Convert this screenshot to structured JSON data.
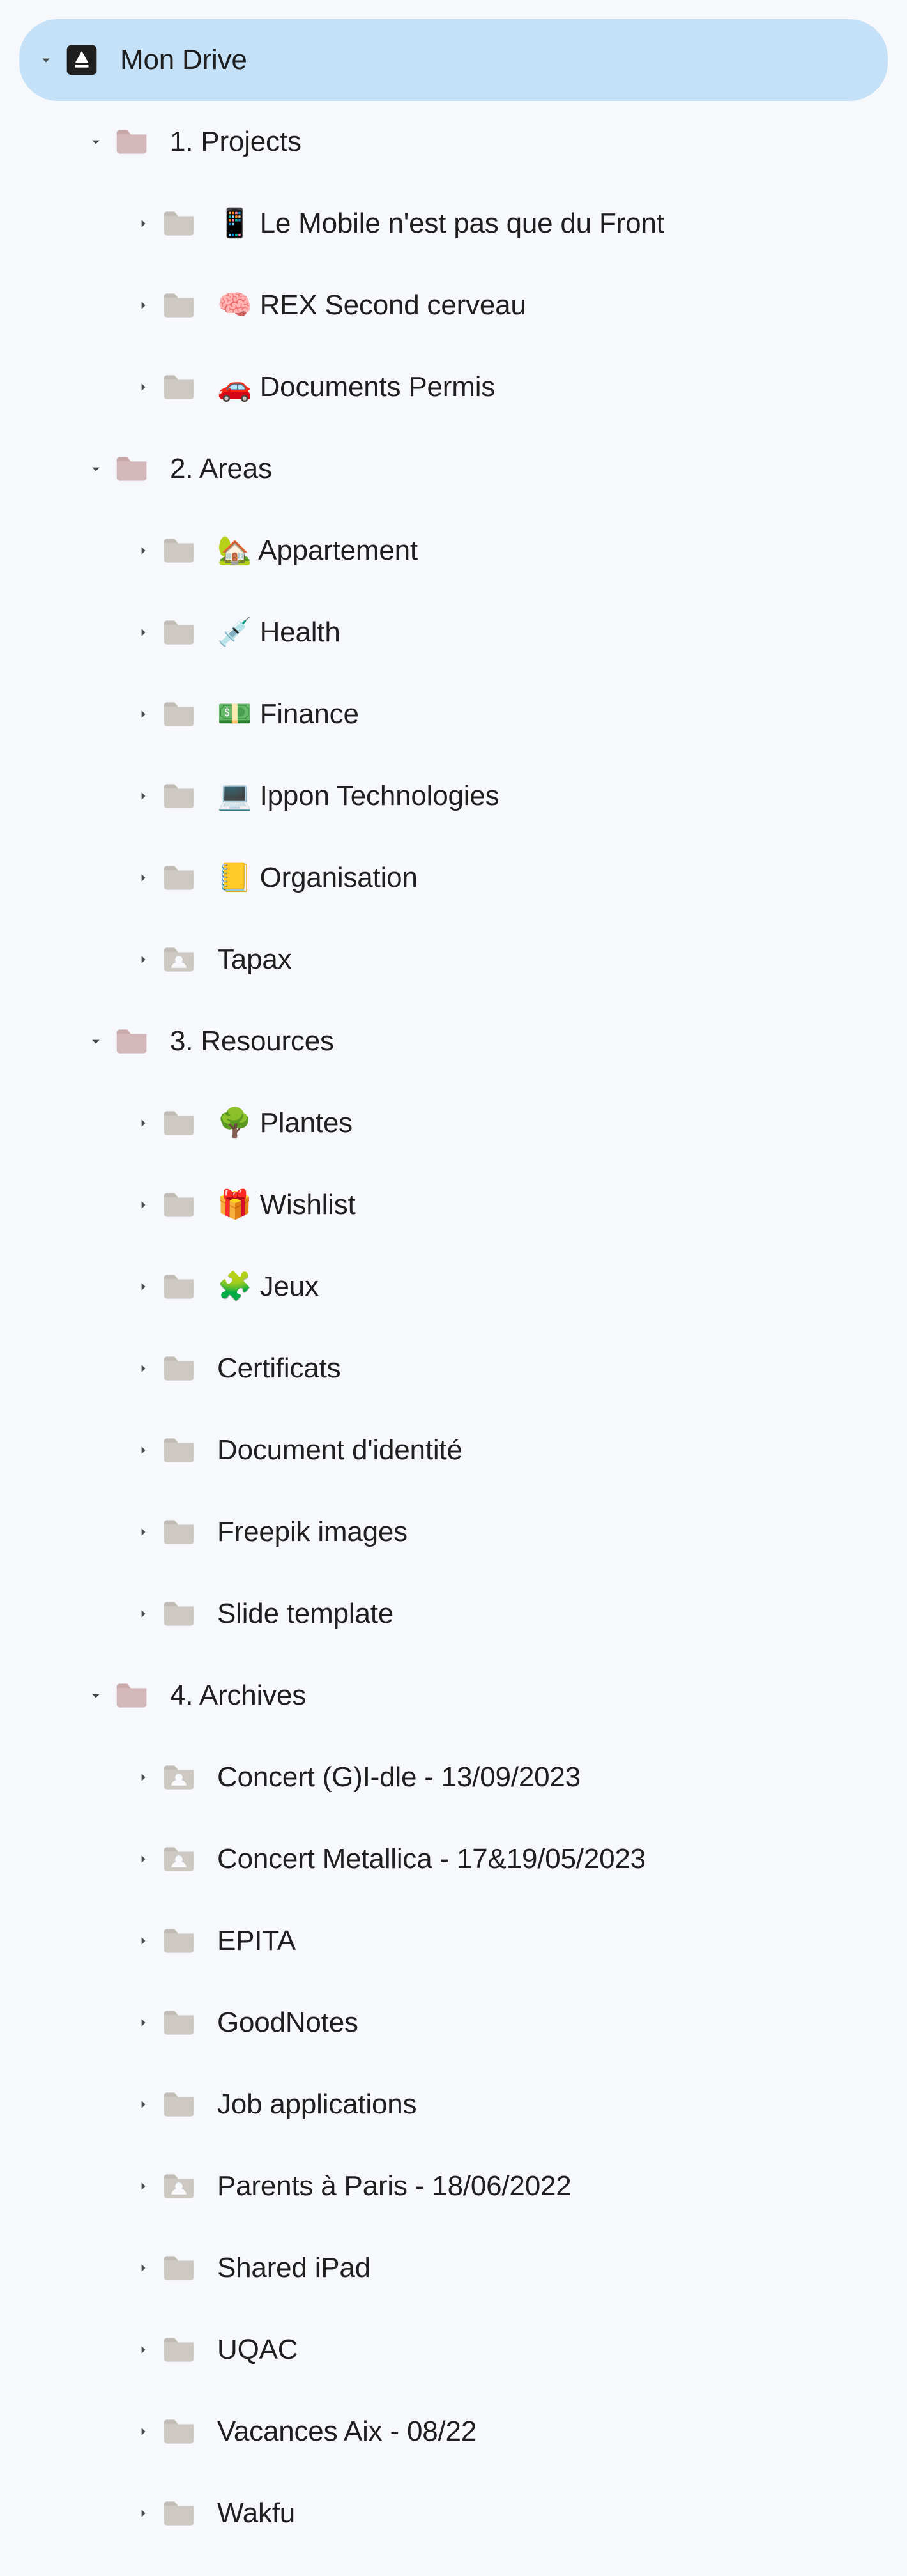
{
  "root": {
    "label": "Mon Drive",
    "children": [
      {
        "label": "1. Projects",
        "color": "pink",
        "children": [
          {
            "label": "📱 Le Mobile n'est pas que du Front",
            "color": "grey"
          },
          {
            "label": "🧠 REX Second cerveau",
            "color": "grey"
          },
          {
            "label": "🚗 Documents Permis",
            "color": "grey"
          }
        ]
      },
      {
        "label": "2. Areas",
        "color": "pink",
        "children": [
          {
            "label": "🏡 Appartement",
            "color": "grey"
          },
          {
            "label": "💉 Health",
            "color": "grey"
          },
          {
            "label": "💵 Finance",
            "color": "grey"
          },
          {
            "label": "💻 Ippon Technologies",
            "color": "grey"
          },
          {
            "label": "📒 Organisation",
            "color": "grey"
          },
          {
            "label": "Tapax",
            "color": "grey",
            "shared": true
          }
        ]
      },
      {
        "label": "3. Resources",
        "color": "pink",
        "children": [
          {
            "label": "🌳 Plantes",
            "color": "grey"
          },
          {
            "label": "🎁 Wishlist",
            "color": "grey"
          },
          {
            "label": "🧩 Jeux",
            "color": "grey"
          },
          {
            "label": "Certificats",
            "color": "grey"
          },
          {
            "label": "Document d'identité",
            "color": "grey"
          },
          {
            "label": "Freepik images",
            "color": "grey"
          },
          {
            "label": "Slide template",
            "color": "grey"
          }
        ]
      },
      {
        "label": "4. Archives",
        "color": "pink",
        "children": [
          {
            "label": "Concert (G)I-dle - 13/09/2023",
            "color": "grey",
            "shared": true
          },
          {
            "label": "Concert Metallica - 17&19/05/2023",
            "color": "grey",
            "shared": true
          },
          {
            "label": "EPITA",
            "color": "grey"
          },
          {
            "label": "GoodNotes",
            "color": "grey"
          },
          {
            "label": "Job applications",
            "color": "grey"
          },
          {
            "label": "Parents à Paris - 18/06/2022",
            "color": "grey",
            "shared": true
          },
          {
            "label": "Shared iPad",
            "color": "grey"
          },
          {
            "label": "UQAC",
            "color": "grey"
          },
          {
            "label": "Vacances Aix - 08/22",
            "color": "grey"
          },
          {
            "label": "Wakfu",
            "color": "grey"
          }
        ]
      }
    ]
  }
}
